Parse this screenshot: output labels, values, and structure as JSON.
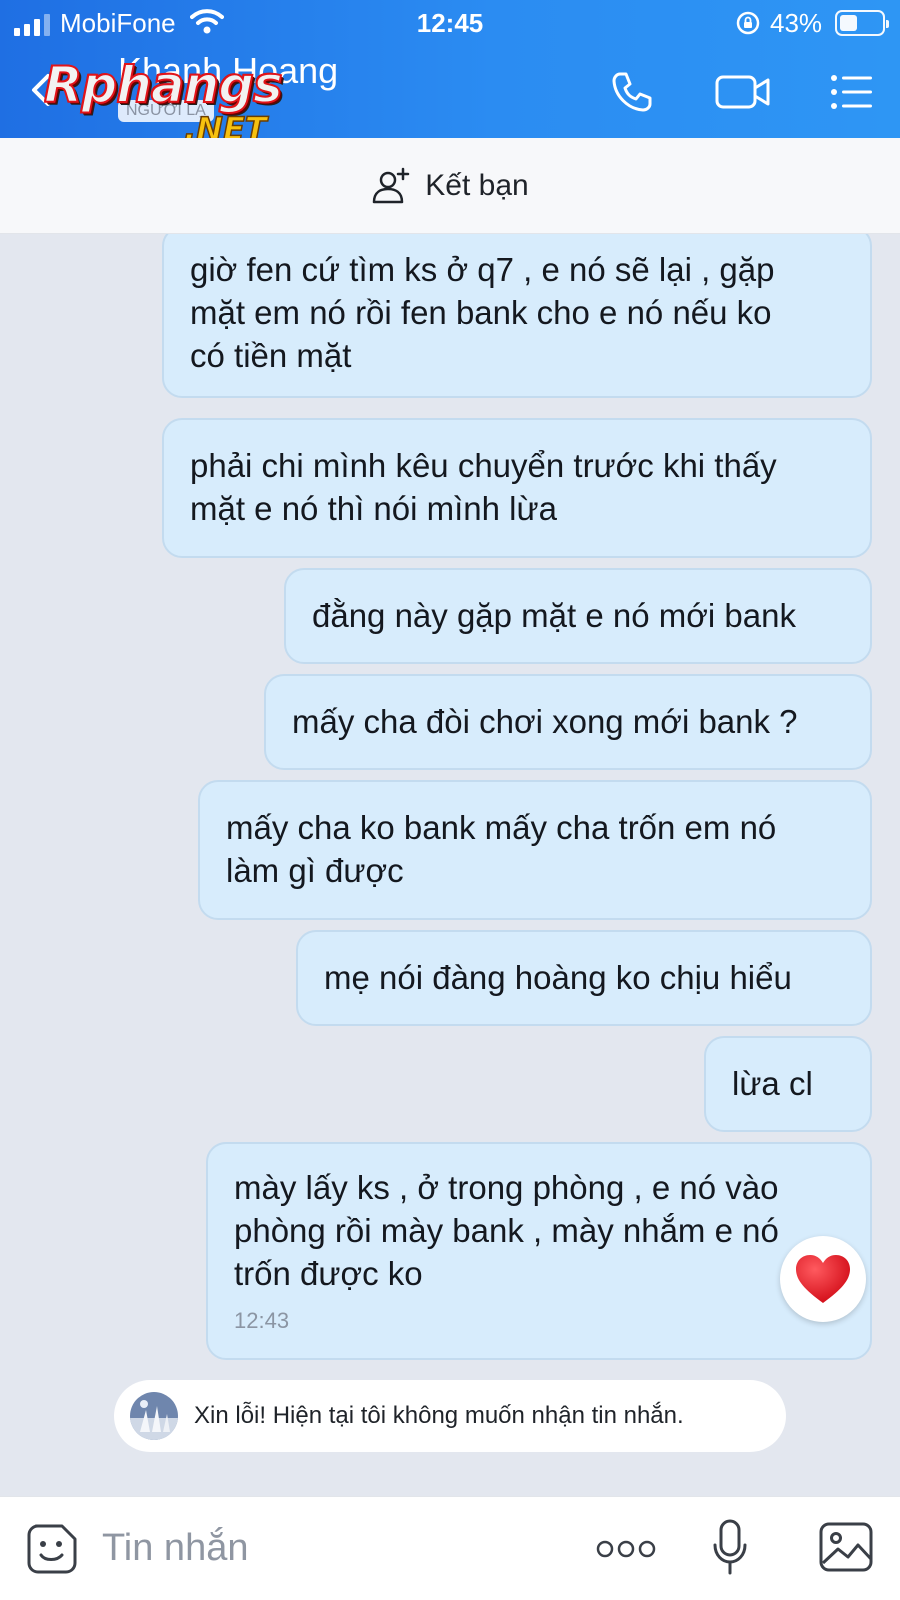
{
  "status_bar": {
    "carrier": "MobiFone",
    "time": "12:45",
    "battery_percent": "43%",
    "battery_level": 0.43
  },
  "header": {
    "contact_name": "Khanh Hoang",
    "contact_badge": "NGƯỜI LẠ",
    "watermark_main": "Rphangs",
    "watermark_sub": ".NET",
    "icons": [
      "back-icon",
      "phone-icon",
      "video-call-icon",
      "menu-list-icon"
    ]
  },
  "friend_bar": {
    "label": "Kết bạn",
    "icon": "add-friend-icon"
  },
  "messages": [
    {
      "text": "giờ fen cứ tìm ks ở q7 , e nó sẽ lại , gặp\nmặt em nó rồi fen bank cho e nó nếu ko\ncó tiền mặt"
    },
    {
      "text": "phải chi mình kêu chuyển trước khi thấy\nmặt e nó thì nói mình lừa"
    },
    {
      "text": "đằng này gặp mặt e nó mới bank"
    },
    {
      "text": "mấy cha đòi chơi xong mới bank ?"
    },
    {
      "text": "mấy cha ko bank mấy cha trốn em nó\nlàm gì được"
    },
    {
      "text": "mẹ nói đàng hoàng ko chịu hiểu"
    },
    {
      "text": "lừa cl"
    },
    {
      "text": "mày lấy ks , ở trong phòng , e nó vào\nphòng rồi mày bank , mày nhắm e nó\ntrốn được ko",
      "time": "12:43",
      "reaction": "heart"
    }
  ],
  "auto_reply": {
    "text": "Xin lỗi! Hiện tại tôi không muốn nhận tin nhắn."
  },
  "input_bar": {
    "placeholder": "Tin nhắn",
    "icons": [
      "sticker-icon",
      "more-icon",
      "microphone-icon",
      "image-icon"
    ]
  },
  "colors": {
    "header_blue": "#2b8cf2",
    "bubble": "#d7ecfc",
    "background": "#e3e7ef",
    "heart": "#e0141e"
  }
}
